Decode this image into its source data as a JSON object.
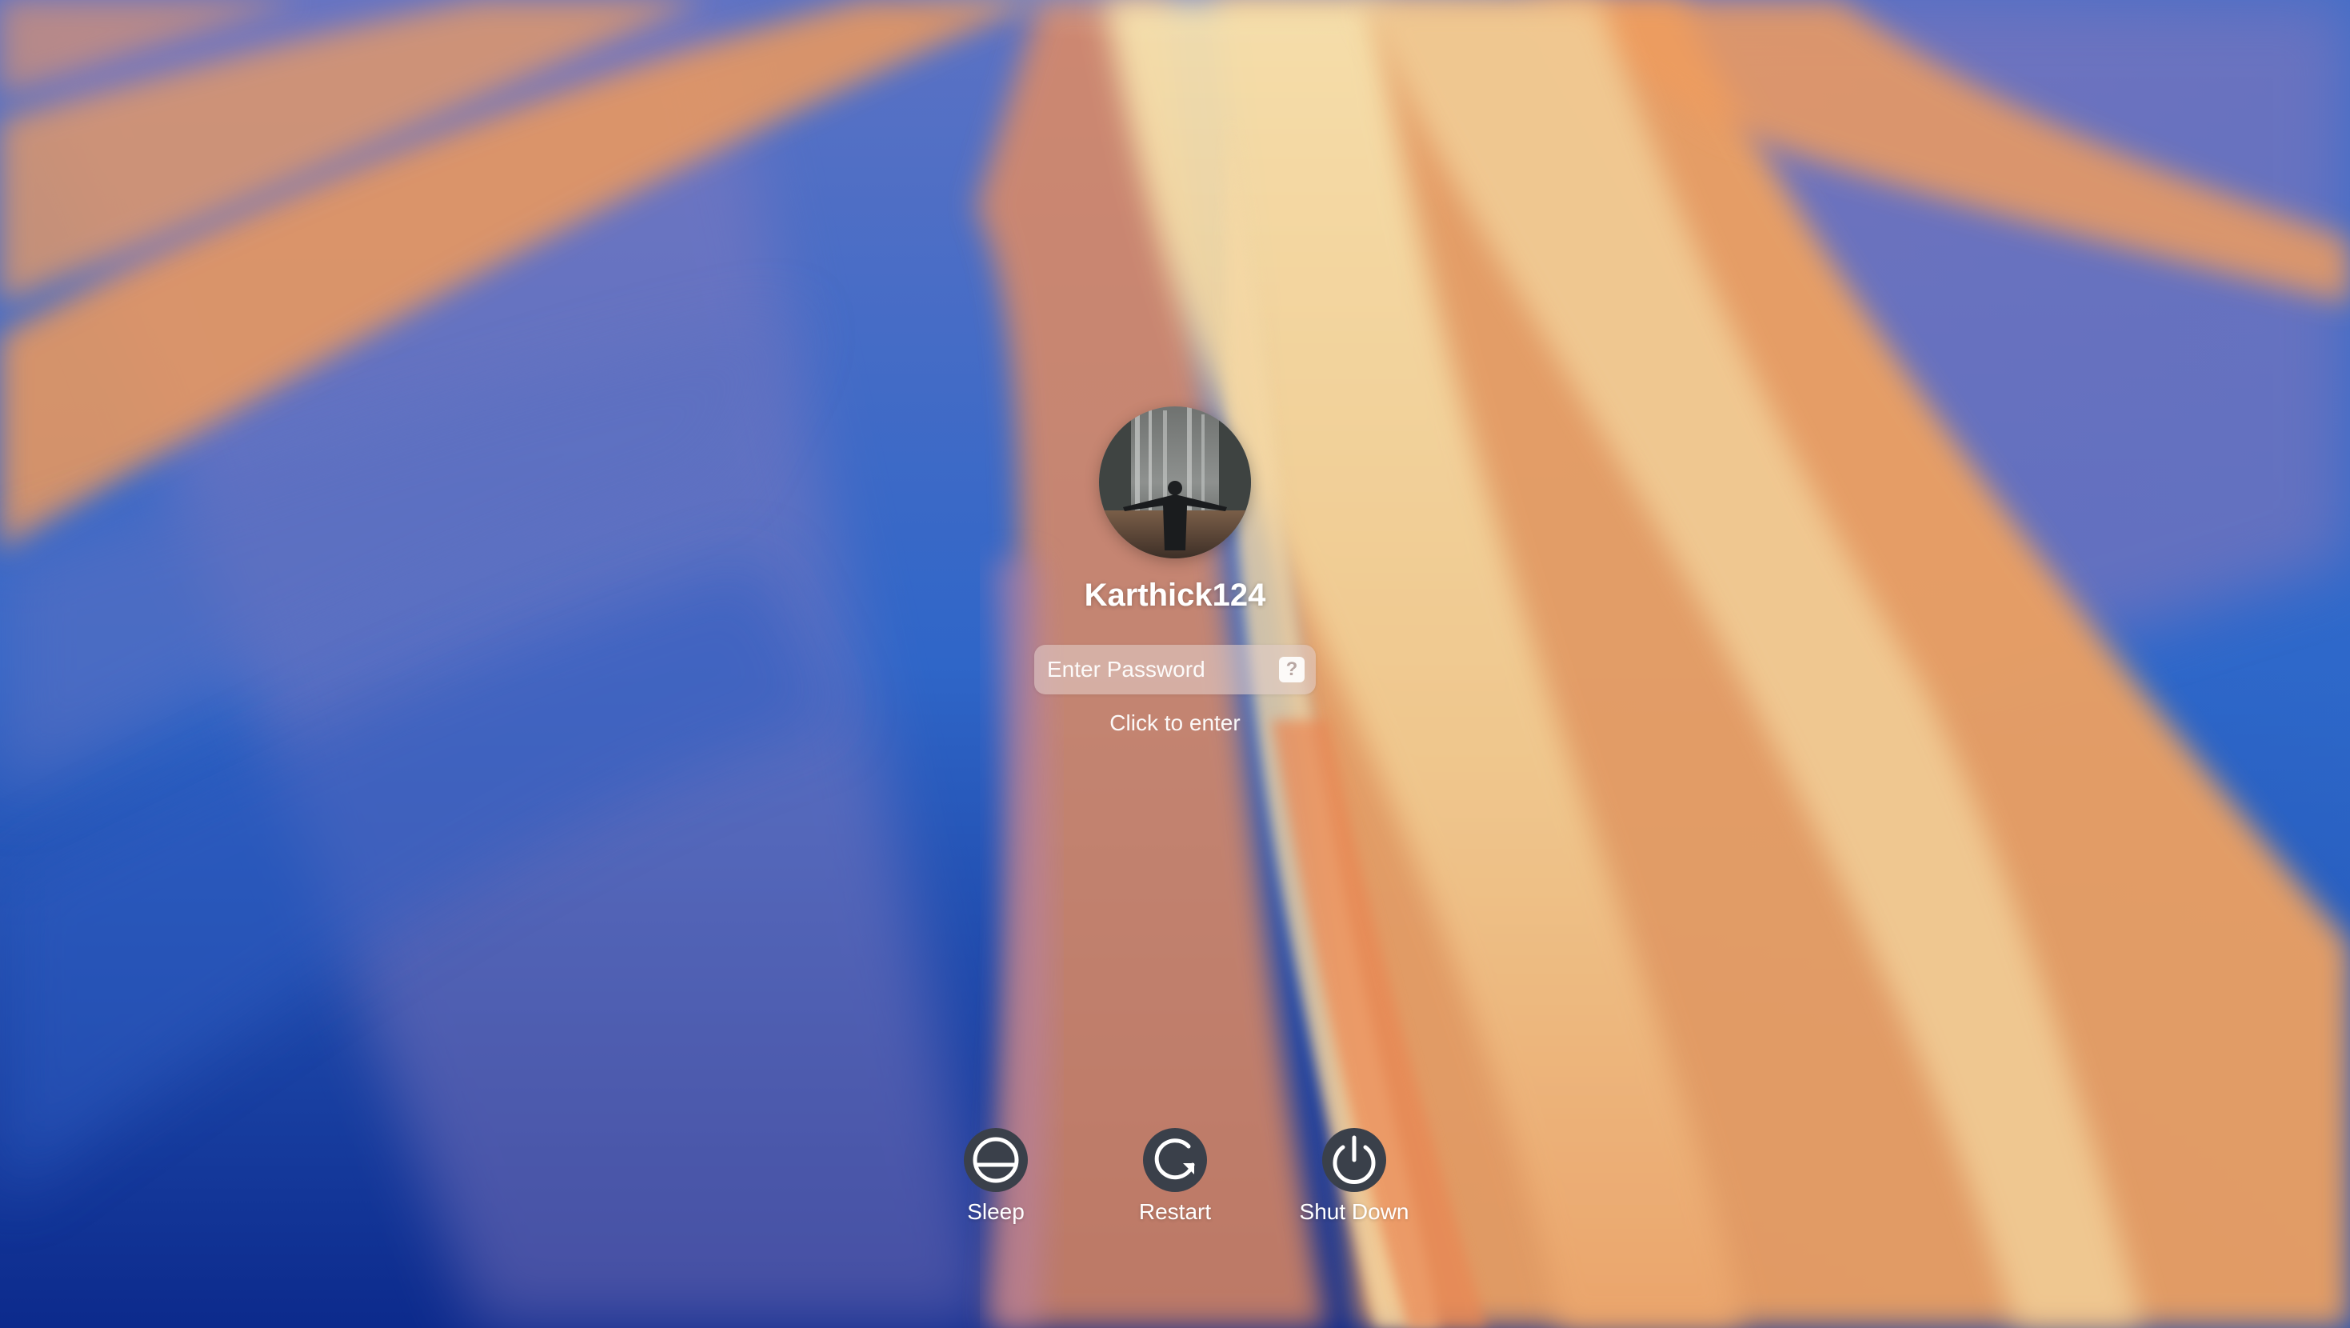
{
  "login": {
    "username": "Karthick124",
    "password_placeholder": "Enter Password",
    "hint_label": "?",
    "enter_hint": "Click to enter"
  },
  "power": {
    "sleep_label": "Sleep",
    "restart_label": "Restart",
    "shutdown_label": "Shut Down"
  },
  "icons": {
    "avatar": "user-avatar-photo",
    "sleep": "sleep-icon",
    "restart": "restart-icon",
    "shutdown": "power-icon",
    "hint": "question-mark-icon"
  },
  "colors": {
    "wallpaper_blue": "#1d4fb8",
    "wallpaper_orange": "#ec9a5e",
    "wallpaper_cream": "#f4dca2",
    "power_button": "#3a404a"
  }
}
